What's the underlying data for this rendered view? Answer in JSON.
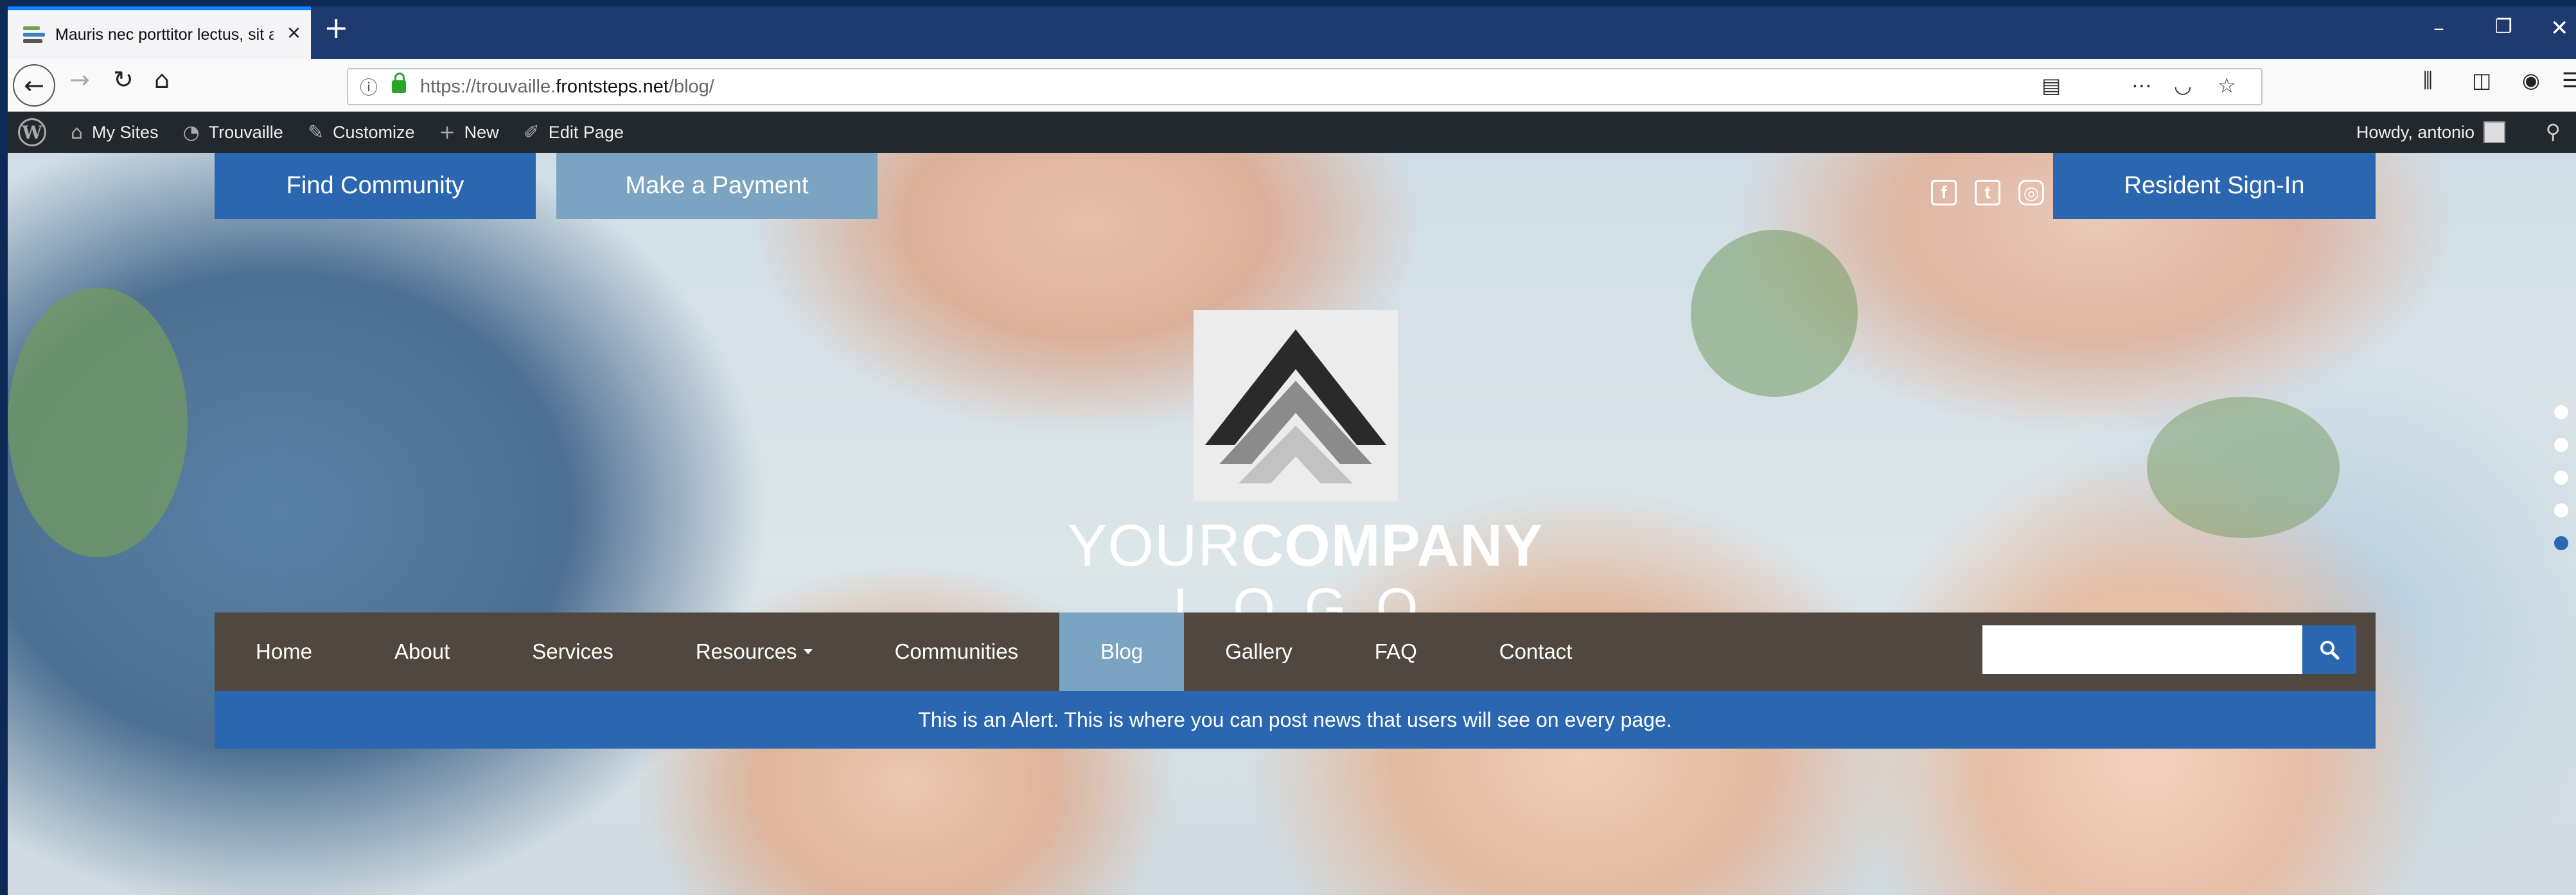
{
  "browser": {
    "tab_title": "Mauris nec porttitor lectus, sit a",
    "tab_close": "×",
    "new_tab": "+",
    "url_domain": "https://trouvaille.",
    "url_host": "frontsteps.net",
    "url_path": "/blog/",
    "window": {
      "minimize": "–",
      "maximize": "❐",
      "close": "✕"
    }
  },
  "admin_bar": {
    "my_sites": "My Sites",
    "site": "Trouvaille",
    "customize": "Customize",
    "new": "New",
    "edit_page": "Edit Page",
    "howdy": "Howdy, antonio"
  },
  "hero": {
    "find_community": "Find Community",
    "make_payment": "Make a Payment",
    "resident_signin": "Resident Sign-In",
    "logo_your": "YOUR",
    "logo_company": "COMPANY",
    "logo_sub": "LOGO",
    "social": {
      "facebook": "f",
      "twitter": "t",
      "instagram": "◎"
    },
    "slides_total": 5,
    "active_slide": 5
  },
  "nav": {
    "items": [
      {
        "label": "Home"
      },
      {
        "label": "About"
      },
      {
        "label": "Services"
      },
      {
        "label": "Resources"
      },
      {
        "label": "Communities"
      },
      {
        "label": "Blog"
      },
      {
        "label": "Gallery"
      },
      {
        "label": "FAQ"
      },
      {
        "label": "Contact"
      }
    ],
    "search_value": ""
  },
  "alert": {
    "text": "This is an Alert. This is where you can post news that users will see on every page."
  },
  "colors": {
    "primary_blue": "#2b67b0",
    "light_blue": "#7aa4c1",
    "nav_bg": "#504741",
    "admin_bar_bg": "#23282d"
  }
}
